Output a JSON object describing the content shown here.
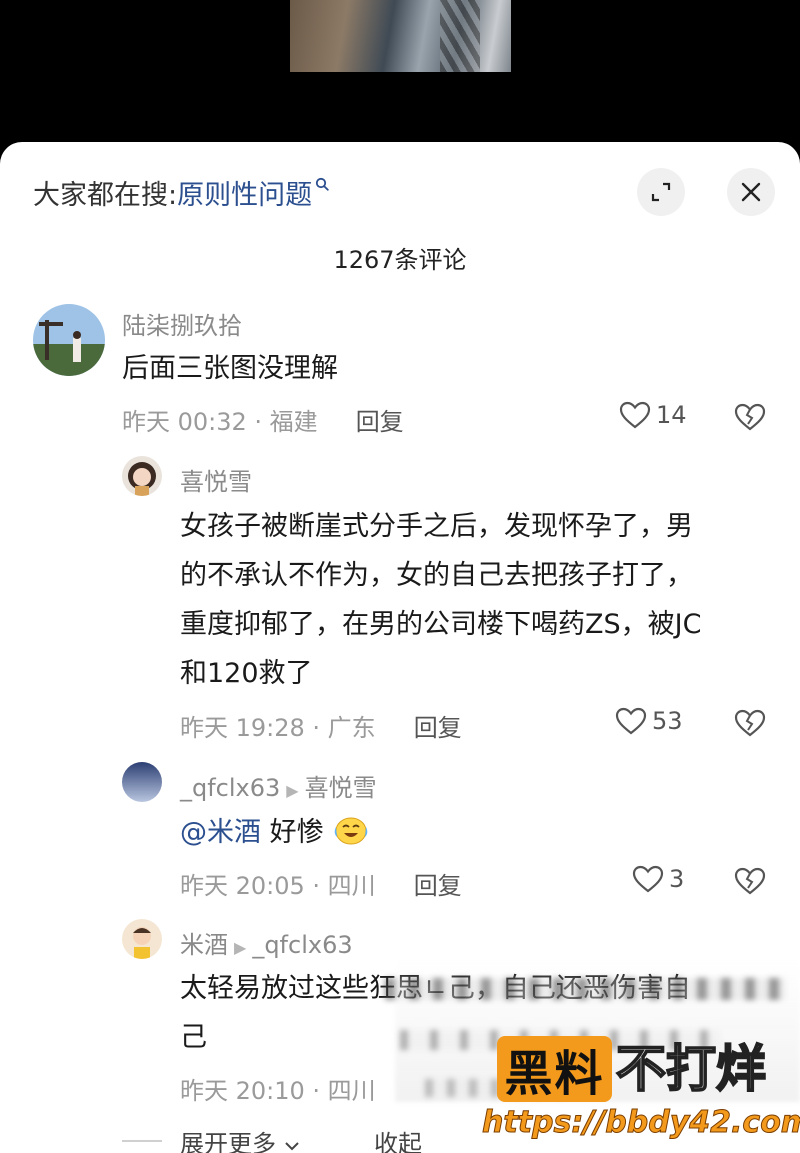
{
  "search": {
    "prefix": "大家都在搜:",
    "term": "原则性问题"
  },
  "comment_count": "1267条评论",
  "comments": [
    {
      "user": "陆柒捌玖拾",
      "text": "后面三张图没理解",
      "time_loc": "昨天 00:32 · 福建",
      "reply_label": "回复",
      "likes": "14",
      "avatar_icon": "scenery-avatar"
    },
    {
      "user": "喜悦雪",
      "text_lines": [
        "女孩子被断崖式分手之后，发现怀孕了，男",
        "的不承认不作为，女的自己去把孩子打了，",
        "重度抑郁了，在男的公司楼下喝药ZS，被JC",
        "和120救了"
      ],
      "time_loc": "昨天 19:28 · 广东",
      "reply_label": "回复",
      "likes": "53",
      "avatar_icon": "girl-avatar"
    },
    {
      "user": "_qfclx63",
      "reply_to": "喜悦雪",
      "mention": "@米酒",
      "text": "好惨",
      "emoji": "crying-laughing-emoji",
      "time_loc": "昨天 20:05 · 四川",
      "reply_label": "回复",
      "likes": "3",
      "avatar_icon": "sky-avatar"
    },
    {
      "user": "米酒",
      "reply_to": "_qfclx63",
      "text_lines": [
        "太轻易放过这些狂思ㄴ己，自己还恶伤害自",
        "己"
      ],
      "time_loc": "昨天 20:10 · 四川",
      "avatar_icon": "child-avatar"
    }
  ],
  "footer": {
    "expand_label": "展开更多",
    "collapse_label": "收起"
  },
  "watermark": {
    "box_text": "黑料",
    "text": "不打烊",
    "url": "https://bbdy42.com"
  },
  "colors": {
    "accent_link": "#2b4f8f",
    "watermark_orange": "#f39a1c"
  }
}
